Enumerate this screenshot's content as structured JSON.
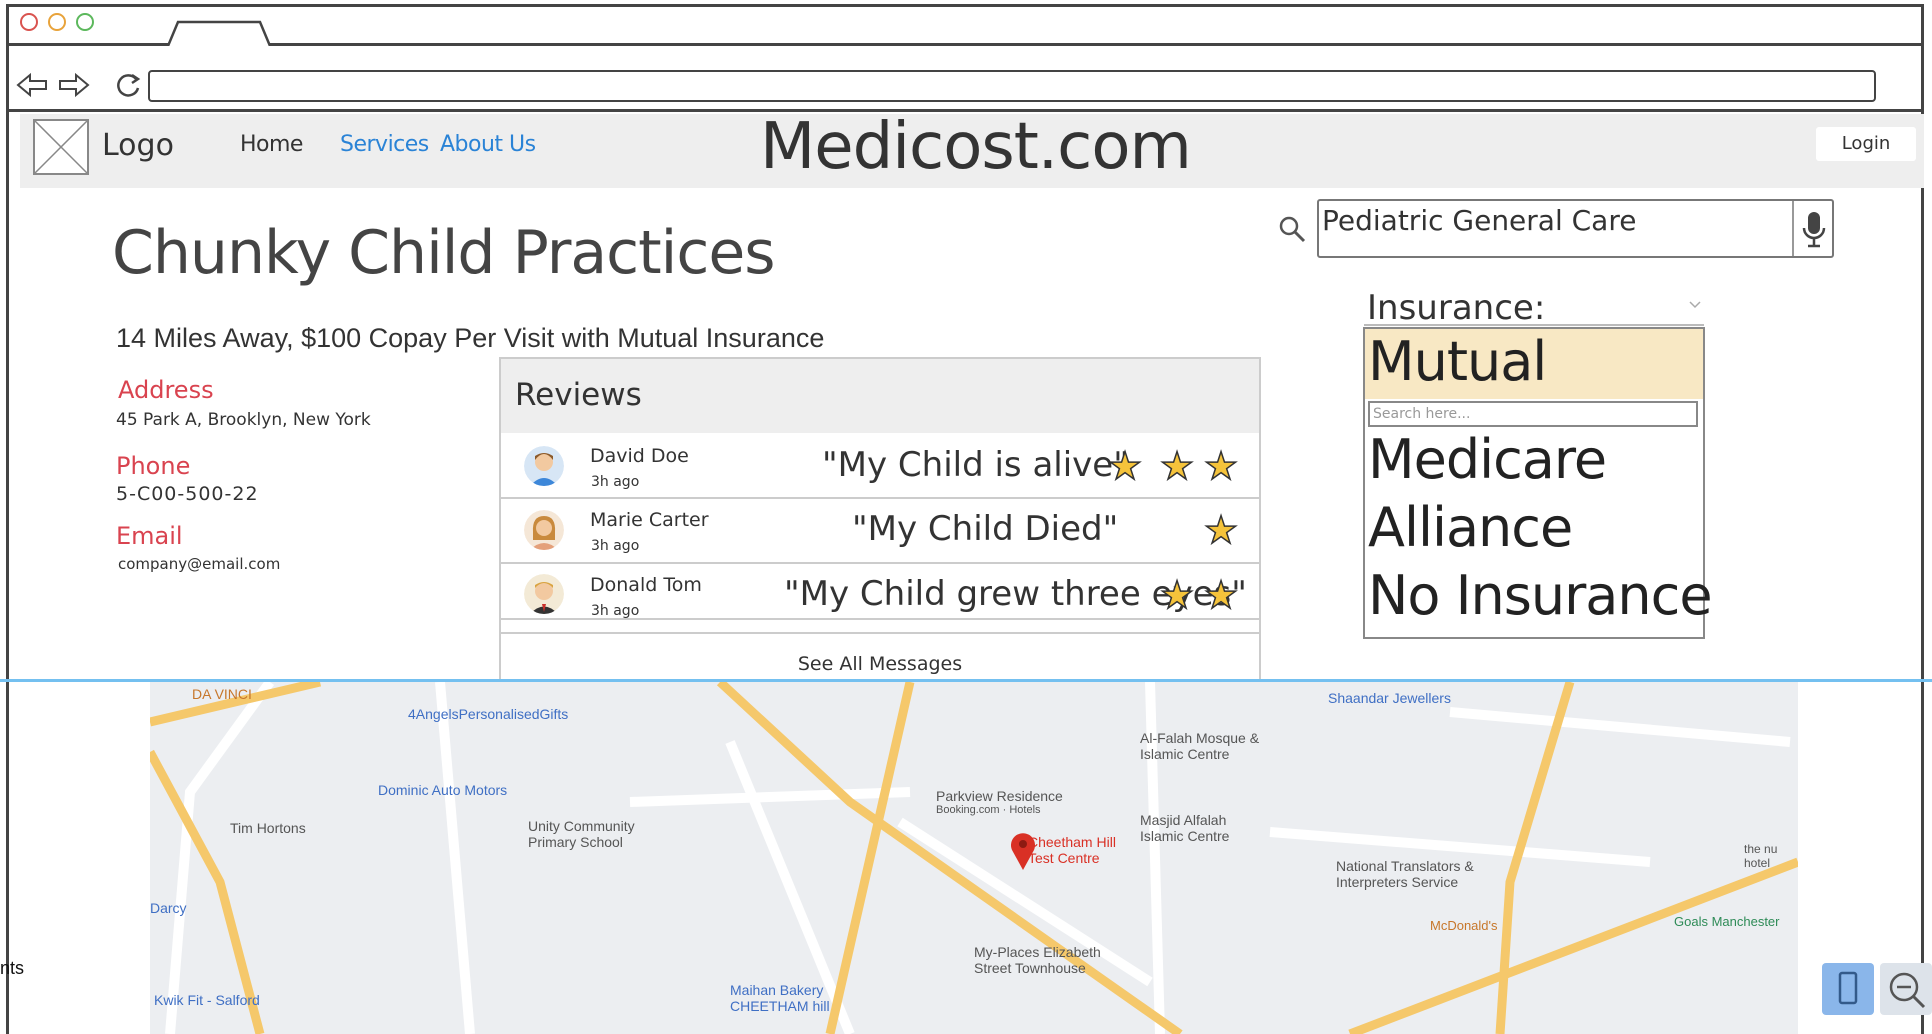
{
  "browser": {
    "url": ""
  },
  "nav": {
    "logo_label": "Logo",
    "home": "Home",
    "services": "Services",
    "about": "About Us",
    "site_title": "Medicost.com",
    "login": "Login"
  },
  "practice": {
    "name": "Chunky Child Practices",
    "summary": "14 Miles Away, $100 Copay Per Visit with Mutual Insurance",
    "address_label": "Address",
    "address": "45 Park A, Brooklyn, New York",
    "phone_label": "Phone",
    "phone": "5-C00-500-22",
    "email_label": "Email",
    "email": "company@email.com"
  },
  "search": {
    "value": "Pediatric General Care"
  },
  "insurance": {
    "label": "Insurance:",
    "selected": "Mutual",
    "search_placeholder": "Search here...",
    "options": [
      "Medicare",
      "Alliance",
      "No Insurance"
    ]
  },
  "reviews": {
    "title": "Reviews",
    "items": [
      {
        "name": "David Doe",
        "time": "3h ago",
        "quote": "\"My Child is alive\"",
        "stars": 3
      },
      {
        "name": "Marie Carter",
        "time": "3h ago",
        "quote": "\"My Child Died\"",
        "stars": 1
      },
      {
        "name": "Donald Tom",
        "time": "3h ago",
        "quote": "\"My Child grew three eyes\"",
        "stars": 2
      }
    ],
    "see_all": "See All Messages"
  },
  "map": {
    "places": [
      "DA VINCI",
      "4AngelsPersonalisedGifts",
      "Dominic Auto Motors",
      "Tim Hortons",
      "Unity Community Primary School",
      "Parkview Residence",
      "Booking.com · Hotels",
      "Cheetham Hill Test Centre",
      "Al-Falah Mosque & Islamic Centre",
      "Masjid Alfalah Islamic Centre",
      "Shaandar Jewellers",
      "National Translators & Interpreters Service",
      "My-Places Elizabeth Street Townhouse",
      "Maihan Bakery CHEETHAM hill",
      "Kwik Fit - Salford",
      "McDonald's",
      "Goals Manchester",
      "Darcy",
      "the nu hotel"
    ]
  },
  "side_text": "nts"
}
